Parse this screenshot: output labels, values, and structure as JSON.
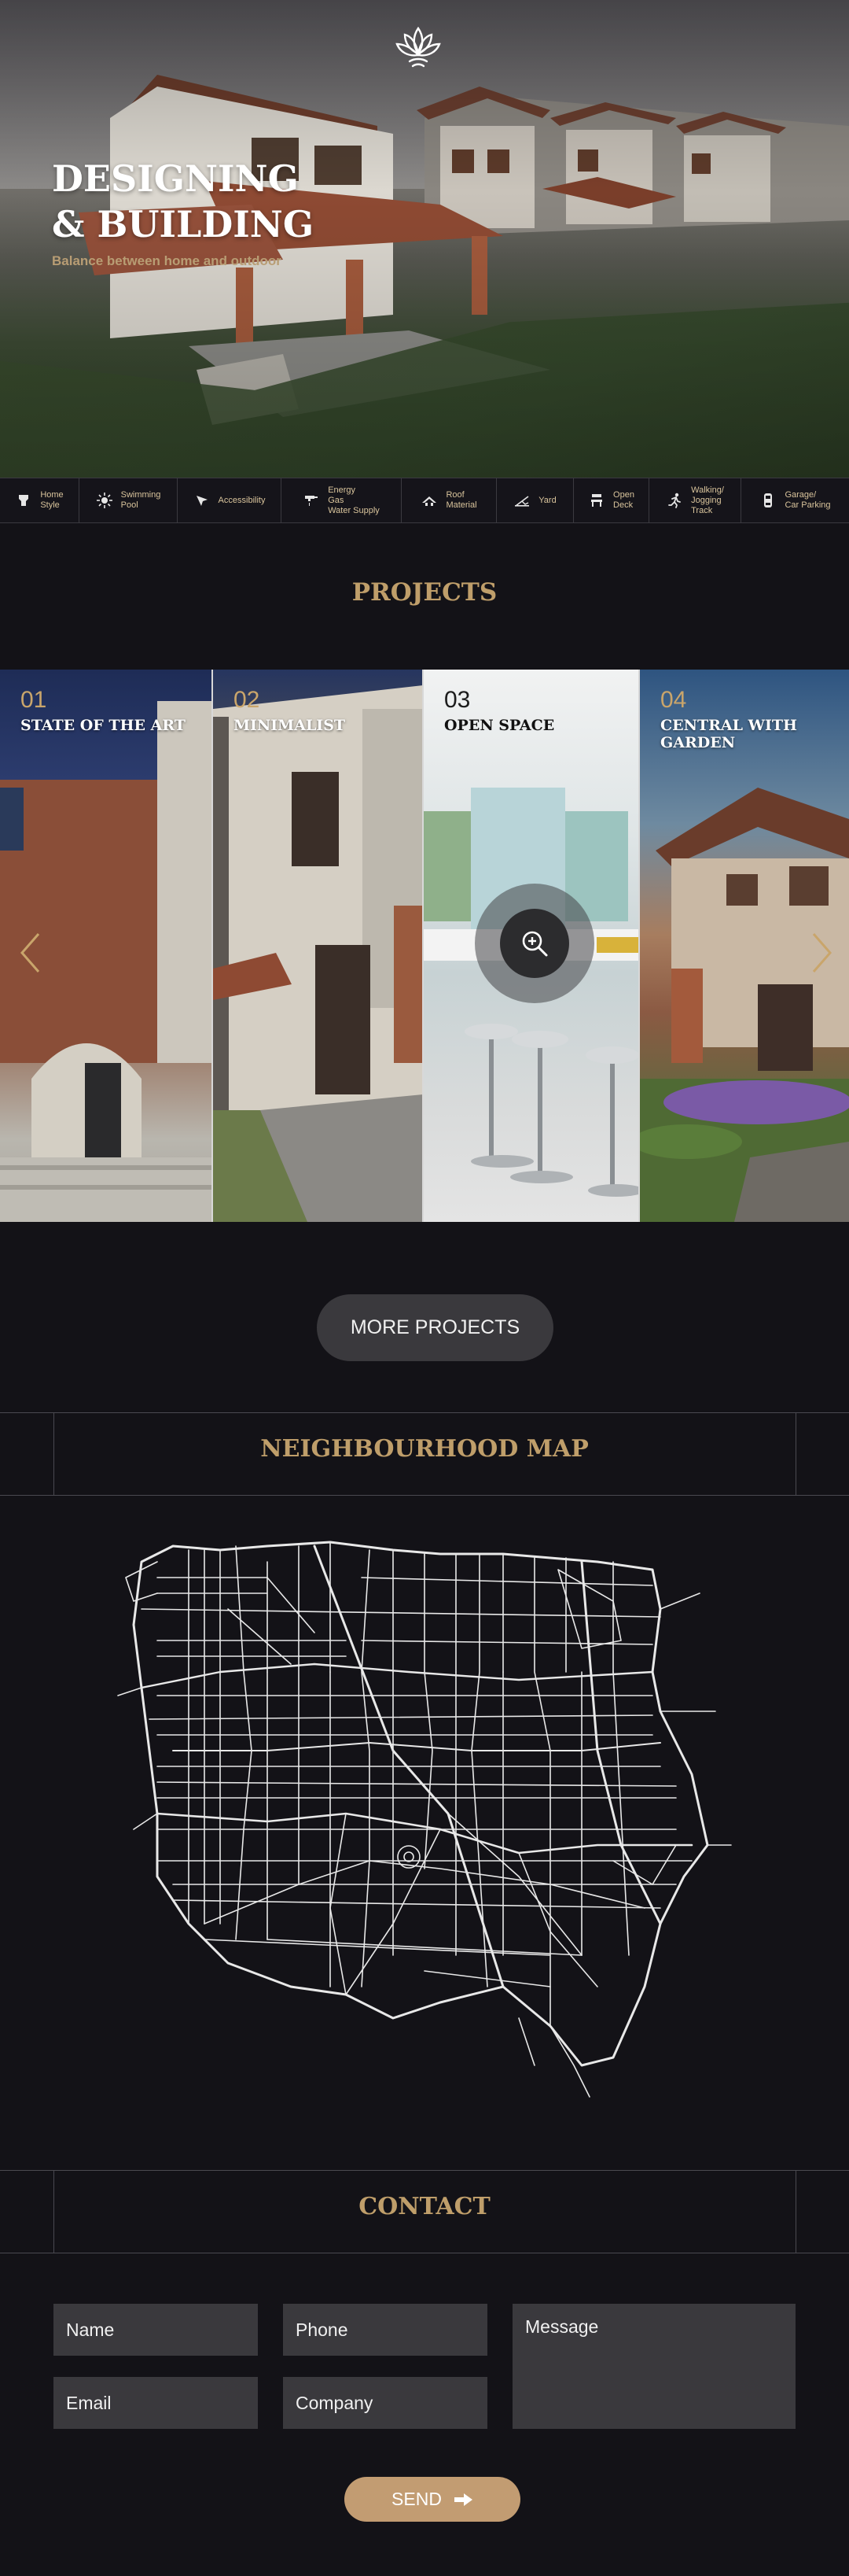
{
  "hero": {
    "title": "DESIGNING\n& BUILDING",
    "subtitle": "Balance between home and outdoor",
    "logo_icon": "lotus-icon"
  },
  "amenities": [
    {
      "label": "Home\nStyle",
      "icon": "house-style-icon"
    },
    {
      "label": "Swimming\nPool",
      "icon": "sun-icon"
    },
    {
      "label": "Accessibility",
      "icon": "location-arrow-icon"
    },
    {
      "label": "Energy\nGas\nWater Supply",
      "icon": "faucet-icon"
    },
    {
      "label": "Roof\nMaterial",
      "icon": "roof-icon"
    },
    {
      "label": "Yard",
      "icon": "yard-icon"
    },
    {
      "label": "Open\nDeck",
      "icon": "deck-icon"
    },
    {
      "label": "Walking/\nJogging\nTrack",
      "icon": "runner-icon"
    },
    {
      "label": "Garage/\nCar Parking",
      "icon": "car-icon"
    }
  ],
  "projects": {
    "title": "PROJECTS",
    "items": [
      {
        "number": "01",
        "name": "STATE OF THE ART"
      },
      {
        "number": "02",
        "name": "MINIMALIST"
      },
      {
        "number": "03",
        "name": "OPEN SPACE"
      },
      {
        "number": "04",
        "name": "CENTRAL WITH GARDEN"
      }
    ],
    "more_label": "MORE PROJECTS"
  },
  "map_section": {
    "title": "NEIGHBOURHOOD MAP"
  },
  "contact": {
    "title": "CONTACT",
    "name_placeholder": "Name",
    "phone_placeholder": "Phone",
    "email_placeholder": "Email",
    "company_placeholder": "Company",
    "message_placeholder": "Message",
    "send_label": "SEND"
  },
  "colors": {
    "background": "#131217",
    "accent_gold": "#bf9e6a",
    "send_button": "#c29c72",
    "field": "#3a393d"
  }
}
